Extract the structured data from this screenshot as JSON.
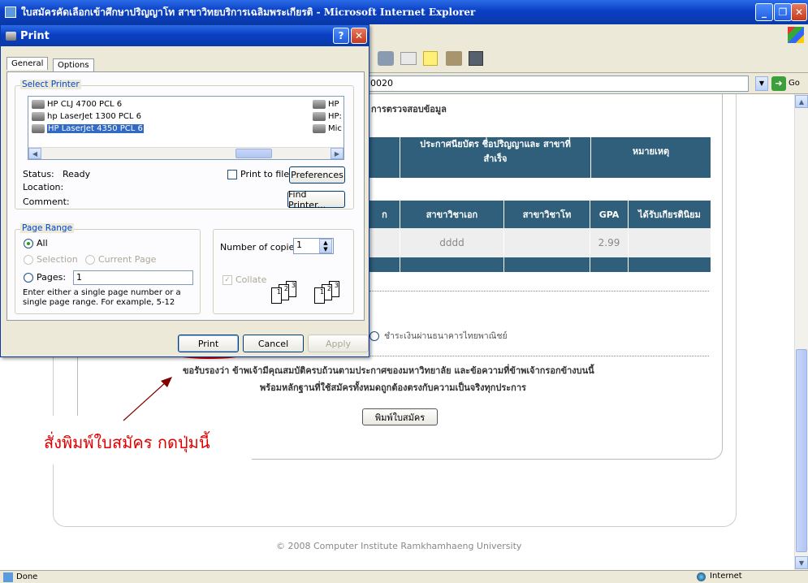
{
  "window": {
    "title": "ใบสมัครคัดเลือกเข้าศึกษาปริญญาโท สาขาวิทยบริการเฉลิมพระเกียรติ - Microsoft Internet Explorer",
    "go_label": "Go",
    "address_value": "0020"
  },
  "status_bar": {
    "left": "Done",
    "zone": "Internet"
  },
  "page": {
    "verify_heading": "การตรวจสอบข้อมูล",
    "table1": {
      "col1": "ประกาศนียบัตร ชื่อปริญญาและ สาขาที่สำเร็จ",
      "col2": "หมายเหตุ"
    },
    "table2": {
      "col0": "ก",
      "col1": "สาขาวิชาเอก",
      "col2": "สาขาวิชาโท",
      "col3": "GPA",
      "col4": "ได้รับเกียรตินิยม",
      "row": {
        "major": "dddd",
        "minor": "",
        "gpa": "2.99",
        "honors": ""
      }
    },
    "payment_option": "ชำระเงินผ่านธนาคารไทยพาณิชย์",
    "certify_line1": "ขอรับรองว่า ข้าพเจ้ามีคุณสมบัติครบถ้วนตามประกาศของมหาวิทยาลัย และข้อความที่ข้าพเจ้ากรอกข้างบนนี้",
    "certify_line2": "พร้อมหลักฐานที่ใช้สมัครทั้งหมดถูกต้องตรงกับความเป็นจริงทุกประการ",
    "print_form_button": "พิมพ์ใบสมัคร",
    "footer": "© 2008 Computer Institute Ramkhamhaeng University"
  },
  "annotation": {
    "text": "สั่งพิมพ์ใบสมัคร กดปุ่มนี้",
    "color": "#e00000"
  },
  "dialog": {
    "title": "Print",
    "tabs": [
      "General",
      "Options"
    ],
    "select_printer_label": "Select Printer",
    "printers": [
      {
        "name": "HP CLJ 4700 PCL 6",
        "selected": false
      },
      {
        "name": "hp LaserJet 1300 PCL 6",
        "selected": false
      },
      {
        "name": "HP LaserJet 4350 PCL 6",
        "selected": true
      }
    ],
    "printers_col2": [
      "HP",
      "HP:",
      "Mic"
    ],
    "status_label": "Status:",
    "status_value": "Ready",
    "location_label": "Location:",
    "comment_label": "Comment:",
    "print_to_file": "Print to file",
    "preferences": "Preferences",
    "find_printer": "Find Printer...",
    "page_range_label": "Page Range",
    "range_all": "All",
    "range_selection": "Selection",
    "range_current": "Current Page",
    "range_pages": "Pages:",
    "pages_value": "1",
    "range_hint": "Enter either a single page number or a single page range.  For example, 5-12",
    "copies_label": "Number of copies:",
    "copies_value": "1",
    "collate_label": "Collate",
    "collate_pages": [
      "1",
      "2",
      "3"
    ],
    "print_button": "Print",
    "cancel_button": "Cancel",
    "apply_button": "Apply"
  },
  "colors": {
    "accent": "#0a3fc4",
    "table_header": "#2f5f7a",
    "highlight_ellipse": "#e00000"
  }
}
